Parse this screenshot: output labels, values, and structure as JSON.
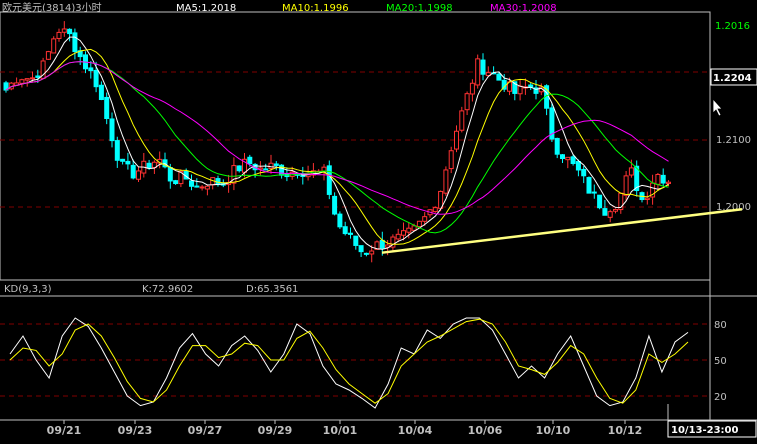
{
  "header": {
    "title": "欧元美元(3814)3小时",
    "ma_labels": [
      {
        "text": "MA5:1.2018",
        "color": "#FFFFFF"
      },
      {
        "text": "MA10:1.1996",
        "color": "#FFFF00"
      },
      {
        "text": "MA20:1.1998",
        "color": "#00FF00"
      },
      {
        "text": "MA30:1.2008",
        "color": "#FF00FF"
      }
    ]
  },
  "price_axis": {
    "ticks": [
      "1.2100",
      "1.2000"
    ],
    "top_value": "1.2016",
    "current_price": "1.2204"
  },
  "kd_header": {
    "name": "KD(9,3,3)",
    "k": "K:72.9602",
    "d": "D:65.3561"
  },
  "kd_axis": {
    "ticks": [
      "80",
      "50",
      "20"
    ]
  },
  "x_axis": {
    "labels": [
      "09/21",
      "09/23",
      "09/27",
      "09/29",
      "10/01",
      "10/04",
      "10/06",
      "10/10",
      "10/12"
    ],
    "cursor_label": "10/13-23:00"
  },
  "colors": {
    "up": "#FF3232",
    "down": "#00FFFF",
    "grid": "#800000",
    "axis": "#C0C0C0",
    "ma5": "#FFFFFF",
    "ma10": "#FFFF00",
    "ma20": "#00FF00",
    "ma30": "#FF00FF",
    "k": "#FFFFFF",
    "d": "#FFFF00",
    "trendline": "#FFFF80"
  },
  "chart_data": [
    {
      "type": "candlestick",
      "title": "欧元美元(3814)3小时",
      "y_ticks": [
        1.21,
        1.2
      ],
      "ylim": [
        1.188,
        1.2245
      ],
      "series": [
        {
          "name": "MA5",
          "value": 1.2018
        },
        {
          "name": "MA10",
          "value": 1.1996
        },
        {
          "name": "MA20",
          "value": 1.1998
        },
        {
          "name": "MA30",
          "value": 1.2008
        }
      ],
      "x_tick_labels": [
        "09/21",
        "09/23",
        "09/27",
        "09/29",
        "10/01",
        "10/04",
        "10/06",
        "10/10",
        "10/12"
      ],
      "close_path": [
        1.214,
        1.216,
        1.2155,
        1.2175,
        1.2225,
        1.2215,
        1.218,
        1.2155,
        1.2095,
        1.2035,
        1.2025,
        1.2035,
        1.2045,
        1.2015,
        1.202,
        1.2005,
        1.2015,
        1.201,
        1.203,
        1.204,
        1.203,
        1.2035,
        1.2025,
        1.203,
        1.2025,
        1.2025,
        1.1955,
        1.1935,
        1.1915,
        1.1925,
        1.193,
        1.1935,
        1.1945,
        1.1965,
        1.1995,
        1.2065,
        1.212,
        1.2175,
        1.2165,
        1.215,
        1.2135,
        1.2145,
        1.214,
        1.2065,
        1.2045,
        1.2025,
        1.1995,
        1.1975,
        1.1985,
        1.203,
        1.1985,
        1.2025,
        1.2015
      ],
      "trendline": [
        {
          "label": "10/03",
          "value": 1.1915
        },
        {
          "label": "10/13",
          "value": 1.1975
        }
      ]
    },
    {
      "type": "line",
      "title": "KD(9,3,3)",
      "y_ticks": [
        80,
        50,
        20
      ],
      "ylim": [
        0,
        100
      ],
      "series": [
        {
          "name": "K",
          "value": 72.9602,
          "values": [
            55,
            70,
            50,
            35,
            70,
            85,
            78,
            60,
            40,
            20,
            12,
            15,
            35,
            60,
            72,
            55,
            45,
            62,
            70,
            58,
            40,
            55,
            80,
            72,
            45,
            30,
            25,
            18,
            10,
            30,
            60,
            55,
            75,
            68,
            80,
            85,
            85,
            75,
            55,
            35,
            45,
            35,
            55,
            70,
            45,
            20,
            12,
            15,
            35,
            70,
            40,
            65,
            73
          ]
        },
        {
          "name": "D",
          "value": 65.3561,
          "values": [
            50,
            60,
            58,
            45,
            55,
            75,
            80,
            70,
            52,
            32,
            18,
            15,
            25,
            45,
            62,
            62,
            52,
            55,
            64,
            62,
            50,
            50,
            68,
            74,
            60,
            42,
            30,
            22,
            14,
            22,
            45,
            55,
            65,
            70,
            76,
            82,
            84,
            80,
            65,
            45,
            42,
            38,
            48,
            62,
            55,
            35,
            18,
            14,
            25,
            55,
            48,
            55,
            65
          ]
        }
      ]
    }
  ]
}
